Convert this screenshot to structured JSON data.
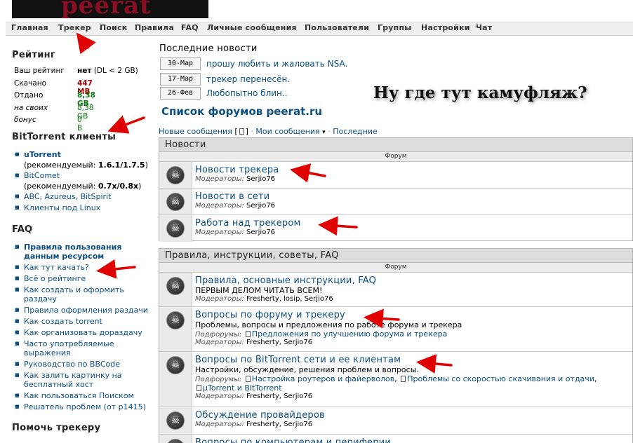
{
  "logo_text": "peerat",
  "nav": [
    "Главная",
    "Трекер",
    "Поиск",
    "Правила",
    "FAQ",
    "Личные сообщения",
    "Пользователи",
    "Группы",
    "Настройки",
    "Чат"
  ],
  "rating": {
    "title": "Рейтинг",
    "rows": [
      {
        "label": "Ваш рейтинг",
        "value": "нет",
        "suffix": "(DL < 2 GB)"
      },
      {
        "label": "Скачано",
        "value": "447 MB"
      },
      {
        "label": "Отдано",
        "value": "8,38 GB"
      },
      {
        "label": "на своих",
        "value": "8,38 GB"
      },
      {
        "label": "бонус",
        "value": "0 B"
      }
    ]
  },
  "clients": {
    "title": "BitTorrent клиенты",
    "utorrent": "uTorrent",
    "utorrent_note": "(рекомендуемый:",
    "utorrent_ver": "1.6.1/1.7.5",
    "bitcomet": "BitComet",
    "bitcomet_note": "(рекомендуемый:",
    "bitcomet_ver": "0.7x/0.8x",
    "abc": "ABC, Azureus, BitSpirit",
    "linux": "Клиенты под Linux"
  },
  "faq": {
    "title": "FAQ",
    "items": [
      "Правила пользования данным ресурсом",
      "Как тут качать?",
      "Всё о рейтинге",
      "Как создать и оформить раздачу",
      "Правила оформления раздачи",
      "Как создать torrent",
      "Как организовать дораздачу",
      "Часто употребляемые выражения",
      "Руководство по BBCode",
      "Как залить картинку на бесплатный хост",
      "Как пользоваться Поиском",
      "Решатель проблем (от p1415)"
    ]
  },
  "help_title": "Помочь трекеру",
  "news": {
    "title": "Последние новости",
    "items": [
      {
        "date": "30-Мар",
        "text": "прошу любить и жаловать NSA."
      },
      {
        "date": "17-Мар",
        "text": "трекер перенесён."
      },
      {
        "date": "26-Фев",
        "text": "Любопытно блин.."
      }
    ]
  },
  "caption": "Ну где тут камуфляж?",
  "forum_list_title": "Список форумов peerat.ru",
  "subnav": {
    "new": "Новые сообщения",
    "mine": "Мои сообщения",
    "last": "Последние"
  },
  "categories": [
    {
      "title": "Новости",
      "col": "Форум",
      "forums": [
        {
          "name": "Новости трекера",
          "mods_label": "Модераторы:",
          "mods": "Serjio76"
        },
        {
          "name": "Новости в сети",
          "mods_label": "Модераторы:",
          "mods": "Serjio76"
        },
        {
          "name": "Работа над трекером",
          "mods_label": "Модераторы:",
          "mods": "Serjio76"
        }
      ]
    },
    {
      "title": "Правила, инструкции, советы, FAQ",
      "col": "Форум",
      "forums": [
        {
          "name": "Правила, основные инструкции, FAQ",
          "desc": "ПЕРВЫМ ДЕЛОМ ЧИТАТЬ ВСЕМ!",
          "mods_label": "Модераторы:",
          "mods": "Fresherty, losip, Serjio76"
        },
        {
          "name": "Вопросы по форуму и трекеру",
          "desc": "Проблемы, вопросы и предложения по работе форума и трекера",
          "subs_label": "Подфорумы:",
          "subs": [
            "Предложения по улучшению форума и трекера"
          ],
          "mods_label": "Модераторы:",
          "mods": "Fresherty, Serjio76"
        },
        {
          "name": "Вопросы по BitTorrent сети и ее клиентам",
          "desc": "Настройки, обсуждение, решения проблем и вопросы.",
          "subs_label": "Подфорумы:",
          "subs": [
            "Настройка роутеров и файерволов",
            "Проблемы со скоростью скачивания и отдачи",
            "µTorrent и BitTorrent"
          ],
          "mods_label": "Модераторы:",
          "mods": "Fresherty, Serjio76"
        },
        {
          "name": "Обсуждение провайдеров",
          "mods_label": "Модераторы:",
          "mods": "Fresherty, Serjio76"
        },
        {
          "name": "Вопросы по компьютерам и периферии"
        }
      ]
    }
  ],
  "colors": {
    "link": "#0b4e82",
    "arrow": "#e00000",
    "logo": "#8a0f24"
  }
}
